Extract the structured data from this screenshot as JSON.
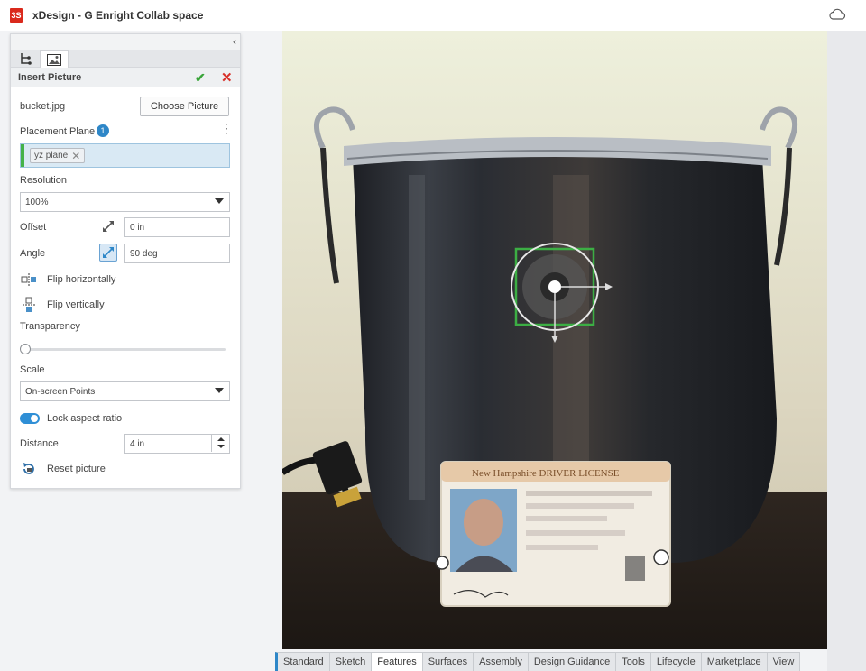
{
  "window": {
    "logo_text": "3S",
    "title": "xDesign - G Enright Collab space"
  },
  "panel": {
    "title": "Insert Picture",
    "file_name": "bucket.jpg",
    "choose_picture_label": "Choose Picture",
    "placement_plane_label": "Placement Plane",
    "placement_plane_count": "1",
    "placement_plane_value": "yz plane",
    "resolution_label": "Resolution",
    "resolution_value": "100%",
    "offset_label": "Offset",
    "offset_value": "0 in",
    "angle_label": "Angle",
    "angle_value": "90 deg",
    "flip_h_label": "Flip horizontally",
    "flip_v_label": "Flip vertically",
    "transparency_label": "Transparency",
    "transparency_value": 0,
    "scale_label": "Scale",
    "scale_value": "On-screen Points",
    "lock_aspect_label": "Lock aspect ratio",
    "lock_aspect_on": true,
    "distance_label": "Distance",
    "distance_value": "4 in",
    "reset_label": "Reset picture"
  },
  "photo": {
    "card_header": "New Hampshire DRIVER LICENSE"
  },
  "tabs": [
    "Standard",
    "Sketch",
    "Features",
    "Surfaces",
    "Assembly",
    "Design Guidance",
    "Tools",
    "Lifecycle",
    "Marketplace",
    "View"
  ],
  "active_tab": "Features",
  "colors": {
    "accent": "#2e87c8",
    "ok": "#3aa53a",
    "cancel": "#d8322b",
    "brand": "#da291c"
  }
}
